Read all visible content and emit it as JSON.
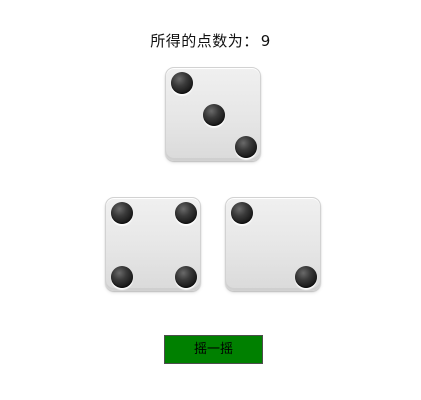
{
  "result": {
    "label": "所得的点数为：",
    "total": "9"
  },
  "dice": [
    {
      "value": 3
    },
    {
      "value": 4
    },
    {
      "value": 2
    }
  ],
  "button": {
    "label": "摇一摇",
    "color": "#008000"
  }
}
